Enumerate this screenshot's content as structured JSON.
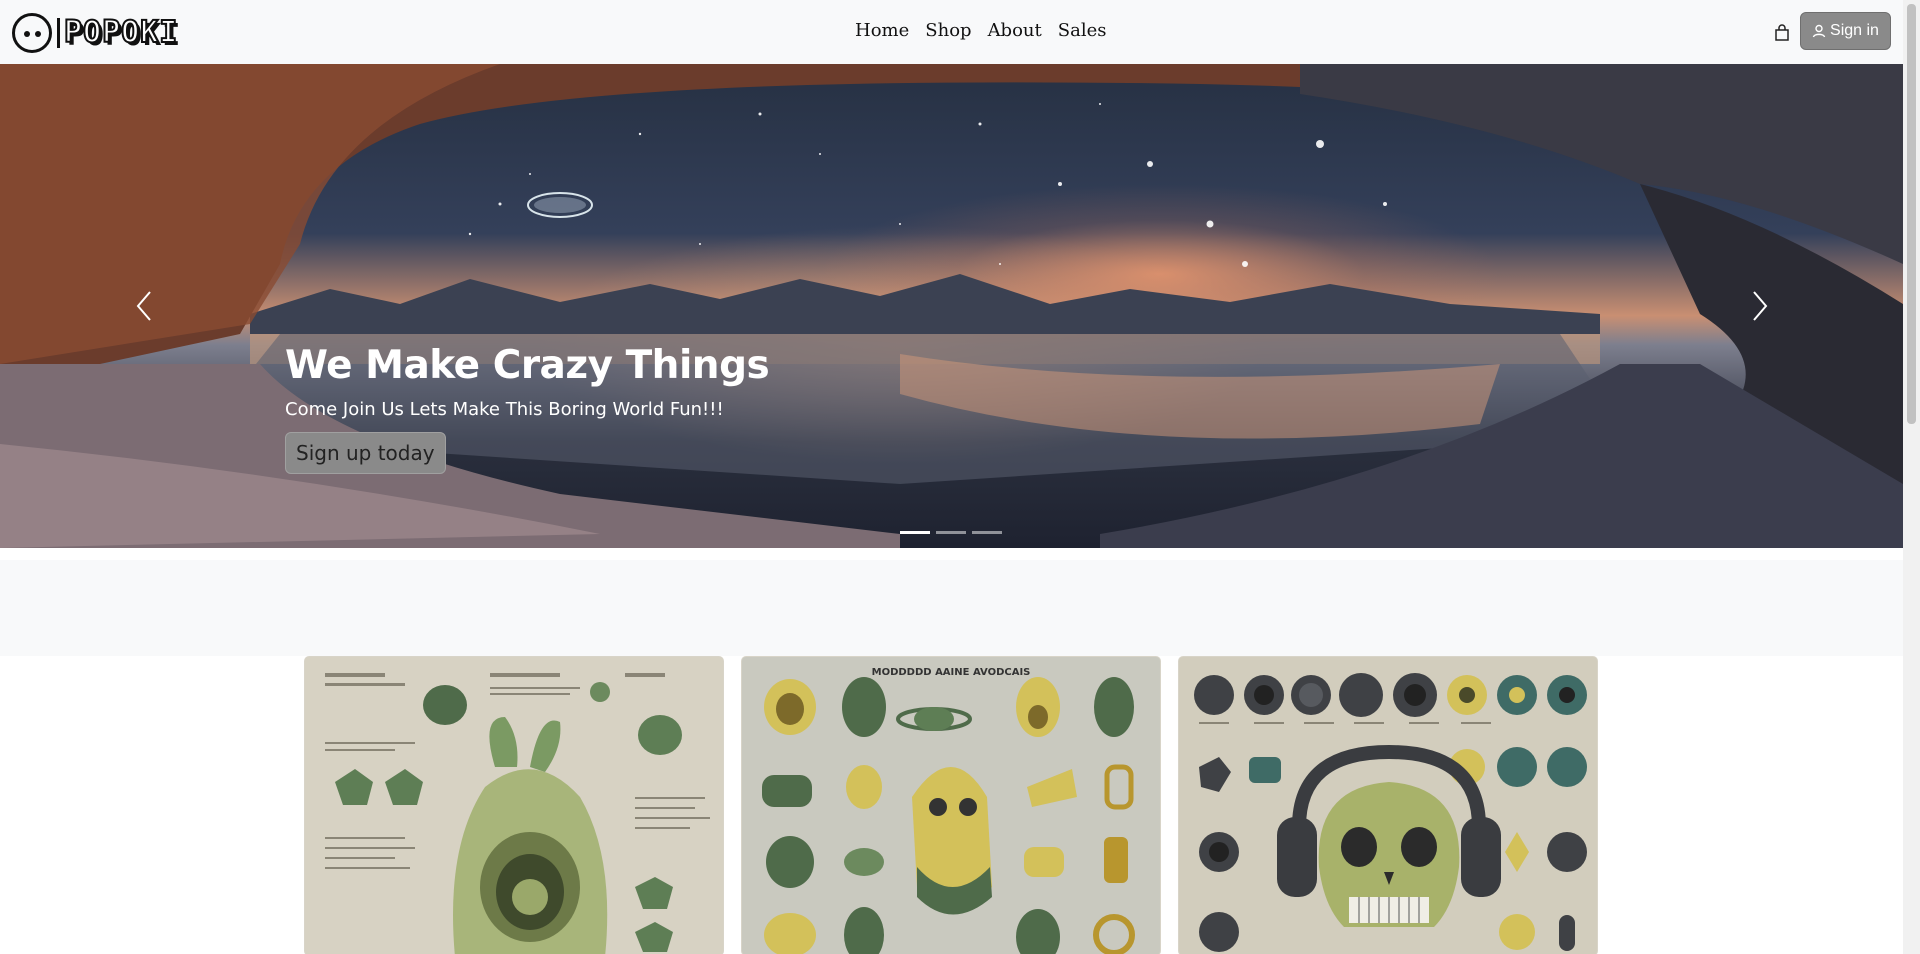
{
  "navbar": {
    "brand": "POPOKI",
    "links": [
      {
        "label": "Home"
      },
      {
        "label": "Shop"
      },
      {
        "label": "About"
      },
      {
        "label": "Sales"
      }
    ],
    "cart_icon": "shopping-bag-icon",
    "signin": {
      "icon": "user-icon",
      "label": "Sign in"
    }
  },
  "hero": {
    "title": "We Make Crazy Things",
    "subtitle": "Come Join Us Lets Make This Boring World Fun!!!",
    "cta": "Sign up today",
    "prev_icon": "chevron-left-icon",
    "next_icon": "chevron-right-icon",
    "slides_count": 3,
    "active_slide": 1
  },
  "cards": [
    {
      "title": "",
      "image": "avocado-backpack-illustration"
    },
    {
      "title": "MODDDDD AAINE AVODCAIS",
      "image": "avocado-gadgets-illustration"
    },
    {
      "title": "",
      "image": "skull-headphones-illustration"
    }
  ],
  "colors": {
    "navbar_bg": "#f8f9fa",
    "button_gray": "#8a8a8a",
    "text_dark": "#111111",
    "avocado_green": "#4f6b4a",
    "avocado_yellow": "#d3c15a"
  }
}
